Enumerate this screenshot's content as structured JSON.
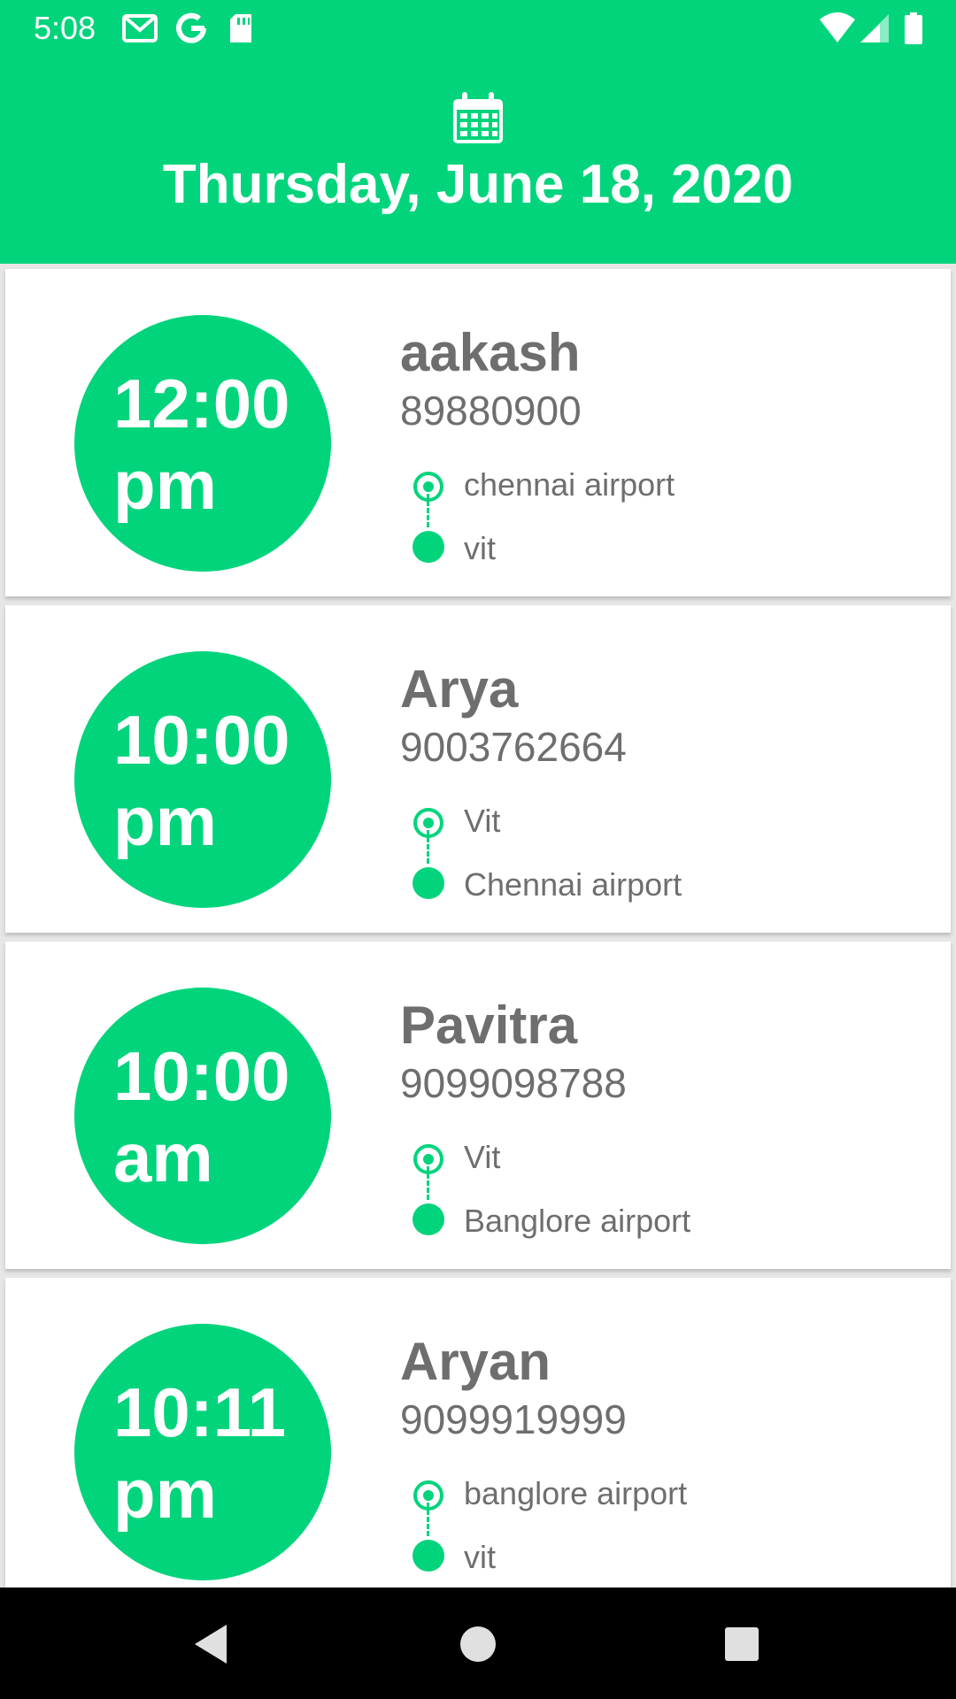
{
  "status_bar": {
    "time": "5:08",
    "icons": [
      "gmail-icon",
      "google-icon",
      "sd-card-icon",
      "wifi-icon",
      "signal-icon",
      "battery-icon"
    ]
  },
  "header": {
    "icon": "calendar-icon",
    "date": "Thursday, June 18, 2020"
  },
  "bookings": [
    {
      "time": "12:00",
      "period": "pm",
      "name": "aakash",
      "phone": "89880900",
      "from": "chennai airport",
      "to": "vit"
    },
    {
      "time": "10:00",
      "period": "pm",
      "name": "Arya",
      "phone": "9003762664",
      "from": "Vit",
      "to": "Chennai airport"
    },
    {
      "time": "10:00",
      "period": "am",
      "name": "Pavitra",
      "phone": "9099098788",
      "from": "Vit",
      "to": "Banglore airport"
    },
    {
      "time": "10:11",
      "period": "pm",
      "name": "Aryan",
      "phone": "9099919999",
      "from": "banglore airport",
      "to": "vit"
    }
  ],
  "nav_bar": {
    "buttons": [
      "back-icon",
      "home-icon",
      "recents-icon"
    ]
  },
  "colors": {
    "accent": "#02d47c",
    "text_gray": "#6e6e6e",
    "card_bg": "#ffffff",
    "list_bg": "#e6e6e6"
  }
}
